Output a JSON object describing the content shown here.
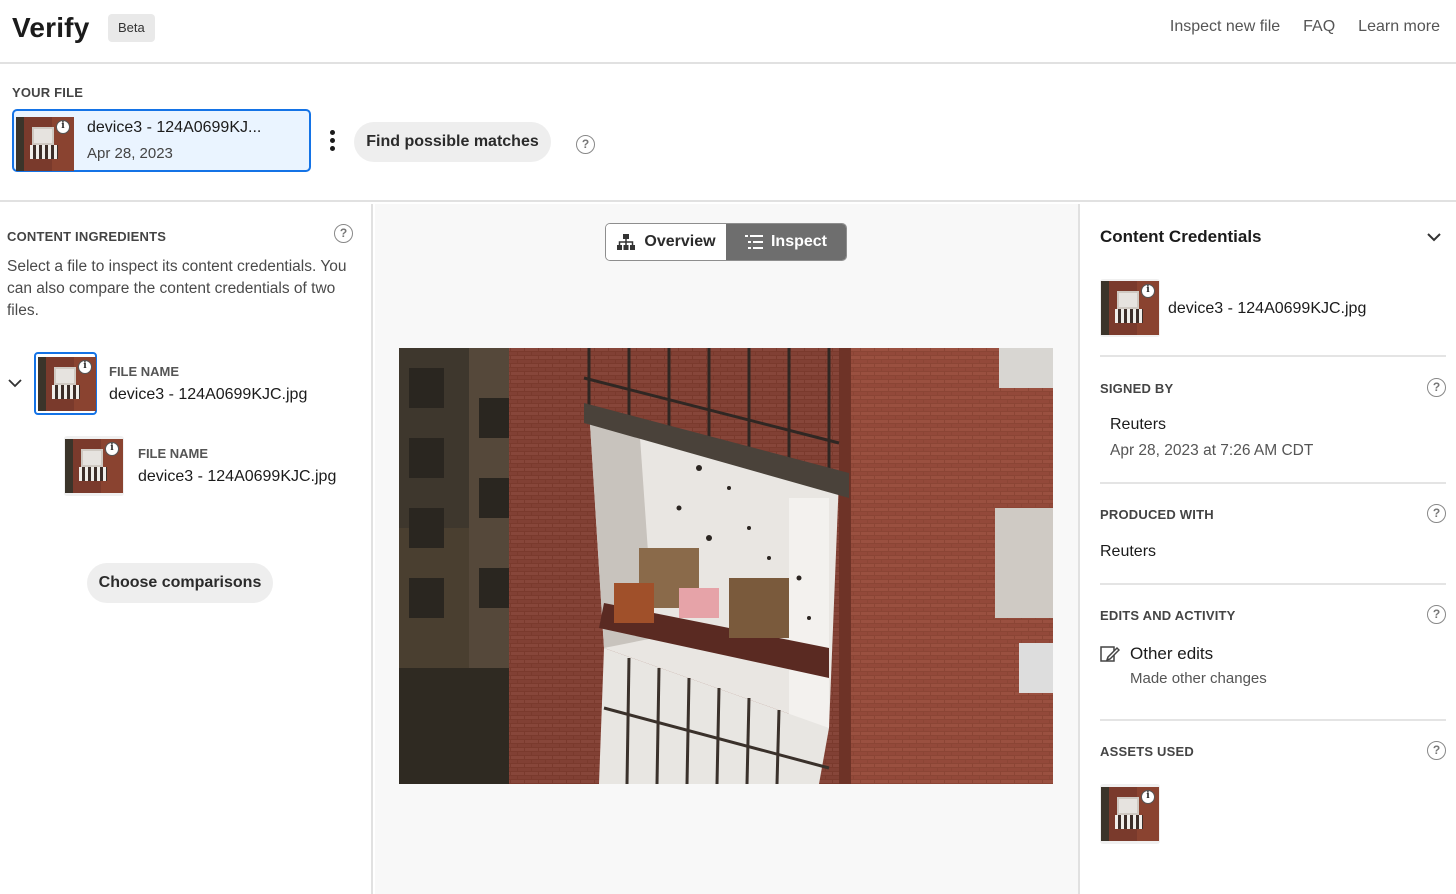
{
  "header": {
    "logo": "Verify",
    "badge": "Beta",
    "nav": [
      "Inspect new file",
      "FAQ",
      "Learn more"
    ]
  },
  "your_file": {
    "label": "YOUR FILE",
    "name": "device3 - 124A0699KJ...",
    "date": "Apr 28, 2023",
    "find_button": "Find possible matches"
  },
  "content_ingredients": {
    "label": "CONTENT INGREDIENTS",
    "description": "Select a file to inspect its content credentials. You can also compare the content credentials of two files.",
    "items": [
      {
        "field_label": "FILE NAME",
        "name": "device3 - 124A0699KJC.jpg"
      },
      {
        "field_label": "FILE NAME",
        "name": "device3 - 124A0699KJC.jpg"
      }
    ],
    "choose_button": "Choose comparisons"
  },
  "view_toggle": {
    "overview": "Overview",
    "inspect": "Inspect",
    "active": "inspect"
  },
  "content_credentials": {
    "title": "Content Credentials",
    "filename": "device3 - 124A0699KJC.jpg",
    "signed_by": {
      "label": "SIGNED BY",
      "issuer": "Reuters",
      "date": "Apr 28, 2023 at 7:26 AM CDT"
    },
    "produced_with": {
      "label": "PRODUCED WITH",
      "value": "Reuters"
    },
    "edits": {
      "label": "EDITS AND ACTIVITY",
      "title": "Other edits",
      "detail": "Made other changes"
    },
    "assets": {
      "label": "ASSETS USED"
    }
  },
  "icons": {
    "help": "help-circle-icon",
    "info": "info-icon",
    "overview": "hierarchy-icon",
    "inspect": "list-icon",
    "edit": "edit-icon",
    "collapse": "chevron-down-icon",
    "more": "more-vertical-icon"
  },
  "colors": {
    "accent": "#1473e6",
    "selected_bg": "#eaf4ff",
    "toggle_active": "#6e6e6e"
  }
}
